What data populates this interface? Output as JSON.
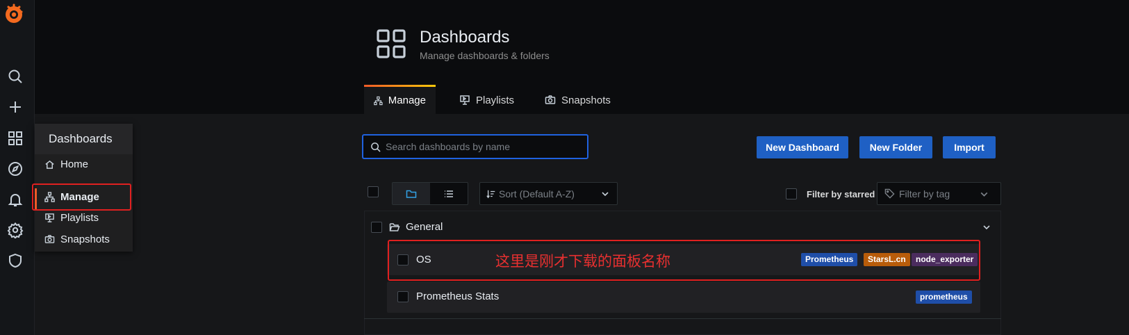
{
  "sidebar": {
    "icons": [
      "grafana-logo-icon",
      "search-icon",
      "plus-icon",
      "dashboards-icon",
      "explore-icon",
      "alerting-bell-icon",
      "settings-gear-icon",
      "shield-icon"
    ]
  },
  "flyout": {
    "title": "Dashboards",
    "items": [
      {
        "label": "Home",
        "icon": "home-icon"
      },
      {
        "label": "Manage",
        "icon": "sitemap-icon"
      },
      {
        "label": "Playlists",
        "icon": "presentation-icon"
      },
      {
        "label": "Snapshots",
        "icon": "camera-icon"
      }
    ]
  },
  "header": {
    "title": "Dashboards",
    "subtitle": "Manage dashboards & folders"
  },
  "tabs": [
    {
      "label": "Manage",
      "active": true
    },
    {
      "label": "Playlists",
      "active": false
    },
    {
      "label": "Snapshots",
      "active": false
    }
  ],
  "search": {
    "placeholder": "Search dashboards by name"
  },
  "buttons": {
    "new_dashboard": "New Dashboard",
    "new_folder": "New Folder",
    "import": "Import"
  },
  "sort": {
    "placeholder": "Sort (Default A-Z)"
  },
  "filter_starred": "Filter by starred",
  "filter_tag": {
    "placeholder": "Filter by tag"
  },
  "folder": {
    "name": "General"
  },
  "dashboards": [
    {
      "title": "OS",
      "tags": [
        "Prometheus",
        "StarsL.cn",
        "node_exporter"
      ]
    },
    {
      "title": "Prometheus Stats",
      "tags": [
        "prometheus"
      ]
    }
  ],
  "annotation": "这里是刚才下载的面板名称",
  "colors": {
    "accent_blue": "#1f60c4",
    "tag_prometheus": "#1f4ea8",
    "tag_starsl": "#b85c0a",
    "tag_node_exporter": "#4b2c5e",
    "highlight_red": "#e02020"
  }
}
